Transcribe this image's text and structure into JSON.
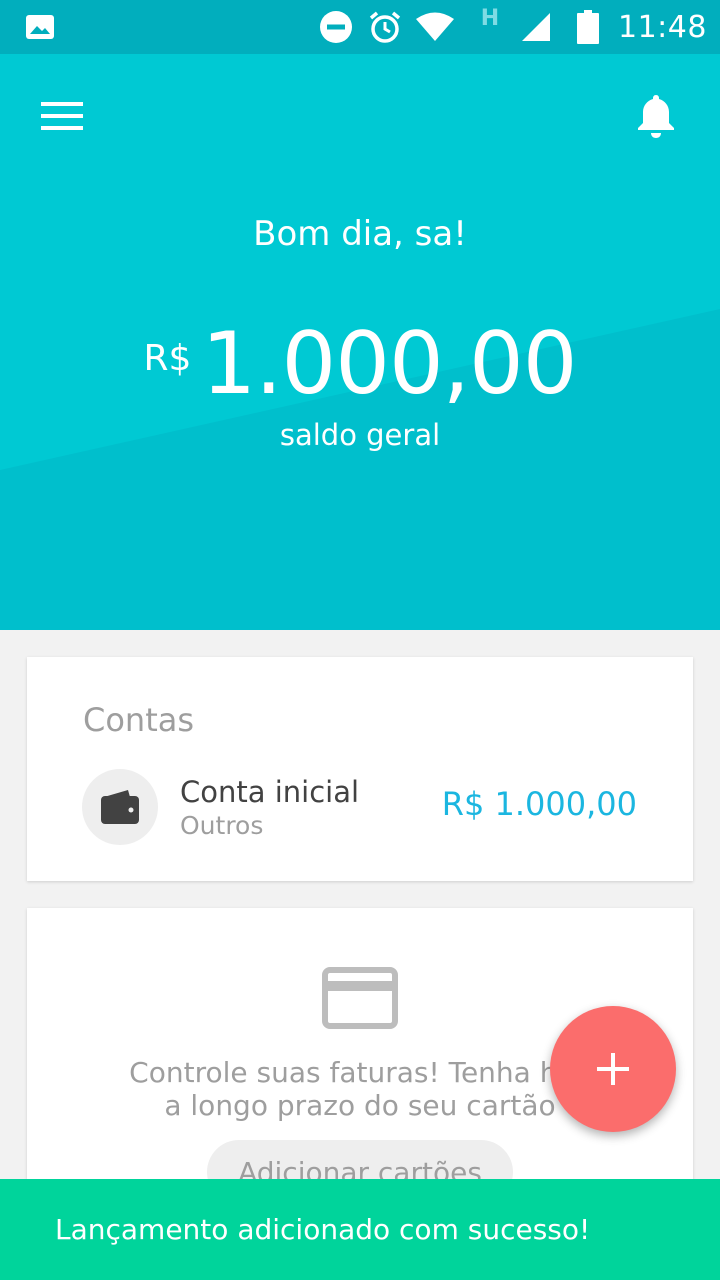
{
  "status_bar": {
    "time": "11:48",
    "network_type": "H",
    "icons": [
      "image-icon",
      "do-not-disturb-icon",
      "alarm-icon",
      "wifi-icon",
      "signal-icon",
      "battery-icon"
    ]
  },
  "header": {
    "greeting": "Bom dia, sa!",
    "currency": "R$",
    "balance": "1.000,00",
    "balance_label": "saldo geral",
    "bg_color": "#00c9d3"
  },
  "accounts": {
    "title": "Contas",
    "items": [
      {
        "name": "Conta inicial",
        "type": "Outros",
        "value": "R$ 1.000,00",
        "icon": "wallet-icon"
      }
    ]
  },
  "cards_section": {
    "icon": "credit-card-icon",
    "promo_line1": "Controle suas faturas! Tenha hist",
    "promo_line2": "a longo prazo do seu cartão",
    "button_label": "Adicionar cartões"
  },
  "fab": {
    "icon": "plus-icon",
    "color": "#fb6d6c"
  },
  "snackbar": {
    "message": "Lançamento adicionado com sucesso!",
    "color": "#00d49b"
  }
}
